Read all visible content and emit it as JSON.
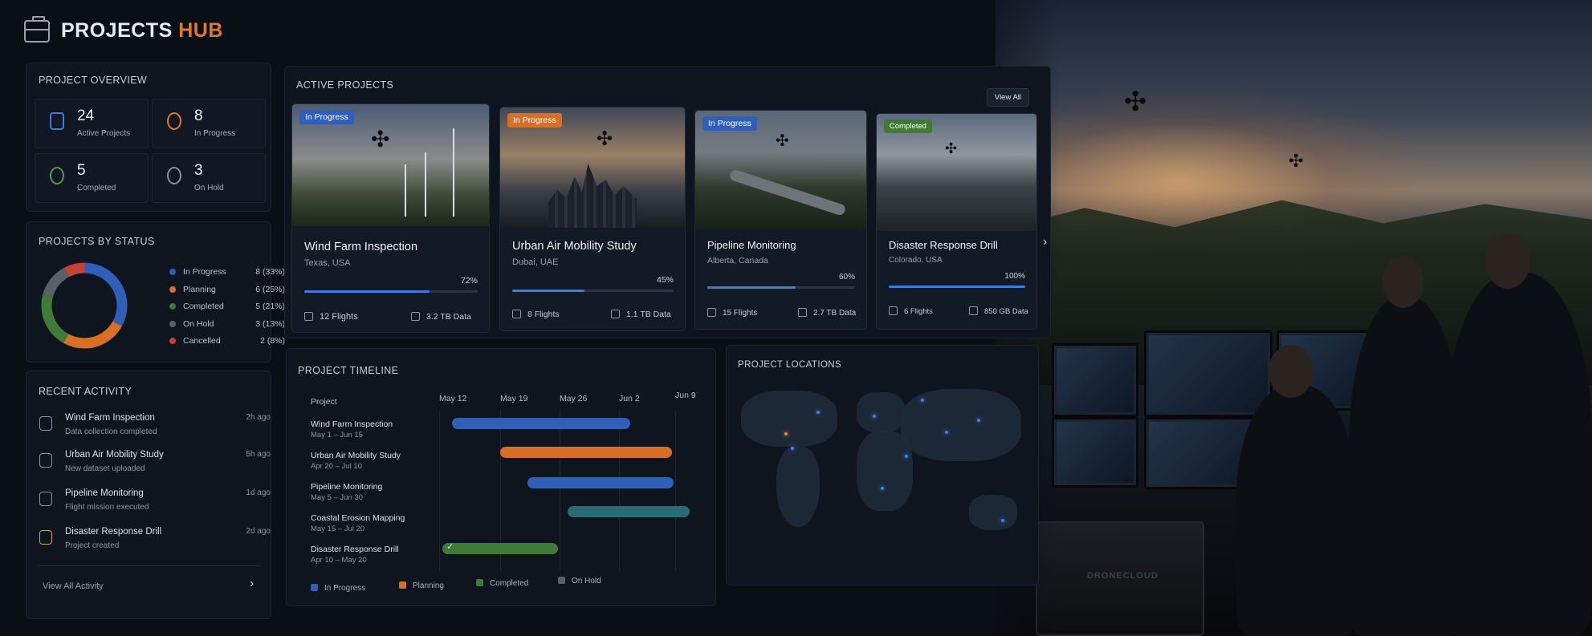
{
  "header": {
    "title_main": "PROJECTS",
    "title_accent": "HUB"
  },
  "overview": {
    "title": "PROJECT OVERVIEW",
    "stats": [
      {
        "value": "24",
        "label": "Active Projects",
        "color": "#3d7be0"
      },
      {
        "value": "8",
        "label": "In Progress",
        "color": "#e0782a"
      },
      {
        "value": "5",
        "label": "Completed",
        "color": "#4f9a47"
      },
      {
        "value": "3",
        "label": "On Hold",
        "color": "#8a909a"
      }
    ]
  },
  "status": {
    "title": "PROJECTS BY STATUS",
    "items": [
      {
        "label": "In Progress",
        "value": "8 (33%)",
        "color": "#2f5fb8",
        "pct": 33
      },
      {
        "label": "Planning",
        "value": "6 (25%)",
        "color": "#d96f26",
        "pct": 25
      },
      {
        "label": "Completed",
        "value": "5 (21%)",
        "color": "#3f7a37",
        "pct": 21
      },
      {
        "label": "On Hold",
        "value": "3 (13%)",
        "color": "#5a606a",
        "pct": 13
      },
      {
        "label": "Cancelled",
        "value": "2 (8%)",
        "color": "#c64235",
        "pct": 8
      }
    ]
  },
  "activity": {
    "title": "RECENT ACTIVITY",
    "items": [
      {
        "title": "Wind Farm Inspection",
        "sub": "Data collection completed",
        "time": "2h ago"
      },
      {
        "title": "Urban Air Mobility Study",
        "sub": "New dataset uploaded",
        "time": "5h ago"
      },
      {
        "title": "Pipeline Monitoring",
        "sub": "Flight mission executed",
        "time": "1d ago"
      },
      {
        "title": "Disaster Response Drill",
        "sub": "Project created",
        "time": "2d ago"
      }
    ],
    "view_all": "View All Activity"
  },
  "active": {
    "title": "ACTIVE PROJECTS",
    "view_all": "View All",
    "cards": [
      {
        "badge": "In Progress",
        "badge_color": "#2f5fb8",
        "title": "Wind Farm Inspection",
        "location": "Texas, USA",
        "progress": "72%",
        "progress_value": 72,
        "flights": "12 Flights",
        "data": "3.2 TB Data",
        "bar_color": "#3d7be0"
      },
      {
        "badge": "In Progress",
        "badge_color": "#d96f26",
        "title": "Urban Air Mobility Study",
        "location": "Dubai, UAE",
        "progress": "45%",
        "progress_value": 45,
        "flights": "8 Flights",
        "data": "1.1 TB Data",
        "bar_color": "#3d7be0"
      },
      {
        "badge": "In Progress",
        "badge_color": "#2f5fb8",
        "title": "Pipeline Monitoring",
        "location": "Alberta, Canada",
        "progress": "60%",
        "progress_value": 60,
        "flights": "15 Flights",
        "data": "2.7 TB Data",
        "bar_color": "#3d7be0"
      },
      {
        "badge": "Completed",
        "badge_color": "#3f7a37",
        "title": "Disaster Response Drill",
        "location": "Colorado, USA",
        "progress": "100%",
        "progress_value": 100,
        "flights": "6 Flights",
        "data": "850 GB Data",
        "bar_color": "#3d7be0"
      }
    ]
  },
  "timeline": {
    "title": "PROJECT TIMELINE",
    "project_header": "Project",
    "columns": [
      "May 12",
      "May 19",
      "May 26",
      "Jun 2",
      "Jun 9"
    ],
    "rows": [
      {
        "title": "Wind Farm Inspection",
        "dates": "May 1 – Jun 15",
        "color": "#2f5fb8"
      },
      {
        "title": "Urban Air Mobility Study",
        "dates": "Apr 20 – Jul 10",
        "color": "#d96f26"
      },
      {
        "title": "Pipeline Monitoring",
        "dates": "May 5 – Jun 30",
        "color": "#2f5fb8"
      },
      {
        "title": "Coastal Erosion Mapping",
        "dates": "May 15 – Jul 20",
        "color": "#2a6a72"
      },
      {
        "title": "Disaster Response Drill",
        "dates": "Apr 10 – May 20",
        "color": "#3f7a37"
      }
    ],
    "legend": [
      {
        "label": "In Progress",
        "color": "#2f5fb8"
      },
      {
        "label": "Planning",
        "color": "#d96f26"
      },
      {
        "label": "Completed",
        "color": "#3f7a37"
      },
      {
        "label": "On Hold",
        "color": "#5a606a"
      }
    ]
  },
  "locations": {
    "title": "PROJECT LOCATIONS"
  },
  "scene": {
    "case_label": "DRONECLOUD"
  }
}
